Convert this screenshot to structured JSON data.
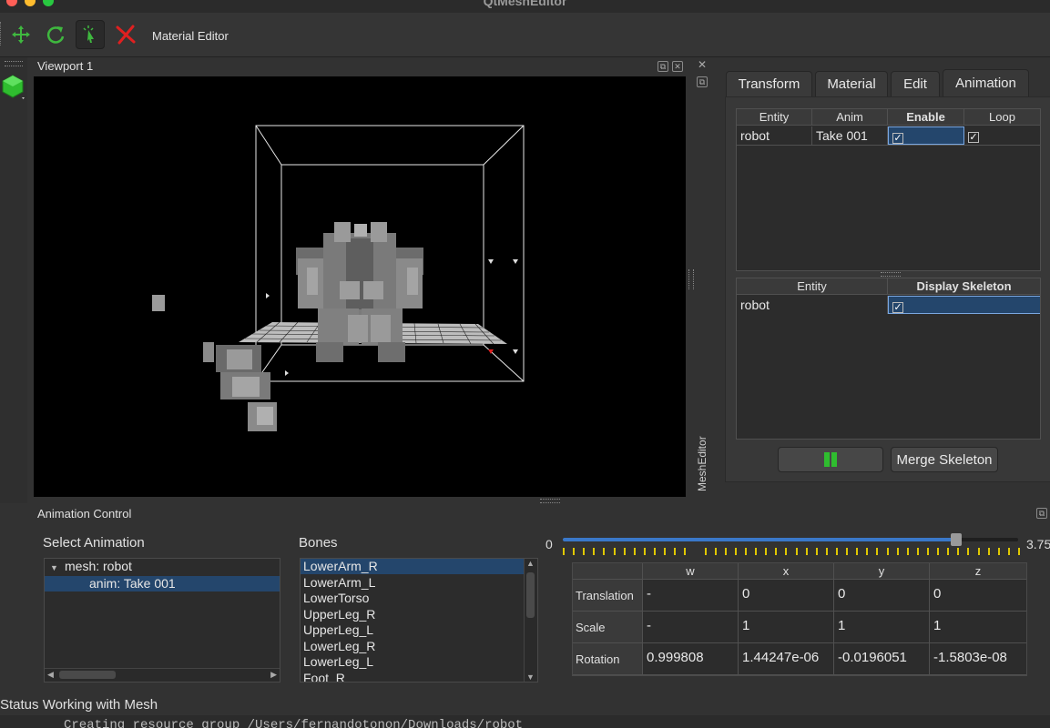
{
  "window": {
    "title": "QtMeshEditor"
  },
  "toolbar": {
    "material_editor_label": "Material Editor"
  },
  "viewport": {
    "title": "Viewport 1"
  },
  "dock": {
    "vertical_label": "MeshEditor"
  },
  "tabs": [
    "Transform",
    "Material",
    "Edit",
    "Animation"
  ],
  "anim_table": {
    "headers": [
      "Entity",
      "Anim",
      "Enable",
      "Loop"
    ],
    "rows": [
      {
        "entity": "robot",
        "anim": "Take 001",
        "enable": true,
        "loop": true
      }
    ]
  },
  "skeleton_table": {
    "headers": [
      "Entity",
      "Display Skeleton"
    ],
    "rows": [
      {
        "entity": "robot",
        "display": true
      }
    ]
  },
  "buttons": {
    "merge_skeleton": "Merge Skeleton"
  },
  "animation_control": {
    "title": "Animation Control",
    "select_label": "Select Animation",
    "tree": {
      "mesh": "mesh: robot",
      "anim": "anim: Take 001"
    },
    "bones_label": "Bones",
    "bones": [
      "LowerArm_R",
      "LowerArm_L",
      "LowerTorso",
      "UpperLeg_R",
      "UpperLeg_L",
      "LowerLeg_R",
      "LowerLeg_L",
      "Foot_R"
    ],
    "slider": {
      "min": "0",
      "max": "3.75",
      "value_fraction": 0.864
    },
    "grid": {
      "cols": [
        "w",
        "x",
        "y",
        "z"
      ],
      "rows": [
        {
          "label": "Translation",
          "values": [
            "-",
            "0",
            "0",
            "0"
          ]
        },
        {
          "label": "Scale",
          "values": [
            "-",
            "1",
            "1",
            "1"
          ]
        },
        {
          "label": "Rotation",
          "values": [
            "0.999808",
            "1.44247e-06",
            "-0.0196051",
            "-1.5803e-08"
          ]
        }
      ]
    }
  },
  "status": {
    "text": "Status Working with Mesh",
    "log": "Creating resource group /Users/fernandotonon/Downloads/robot"
  }
}
